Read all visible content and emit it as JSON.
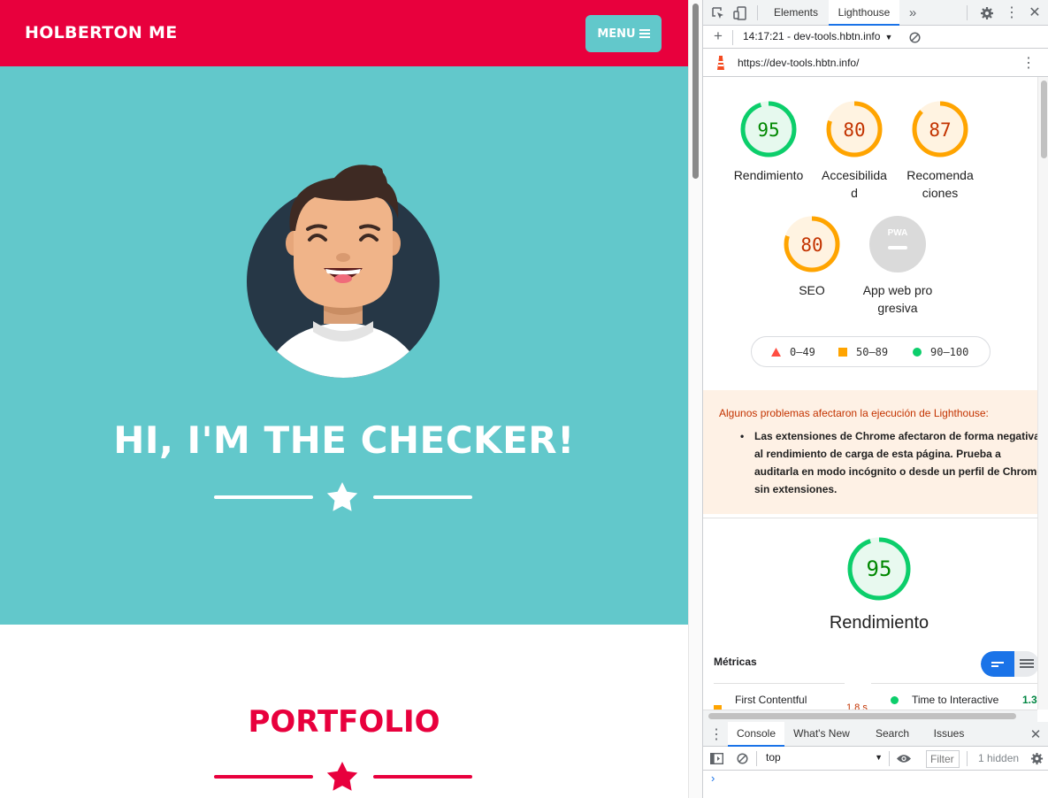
{
  "site": {
    "brand": "HOLBERTON ME",
    "menu_label": "MENU",
    "hero_title": "HI, I'M THE CHECKER!",
    "portfolio_title": "PORTFOLIO",
    "colors": {
      "nav": "#e8003d",
      "hero": "#62c8cb",
      "accent": "#e8003d"
    }
  },
  "devtools": {
    "tabs": [
      "Elements",
      "Lighthouse"
    ],
    "active_tab": "Lighthouse",
    "session": "14:17:21 - dev-tools.hbtn.info",
    "url": "https://dev-tools.hbtn.info/",
    "gauges": [
      {
        "score": "95",
        "label": "Rendimiento",
        "status": "pass"
      },
      {
        "score": "80",
        "label": "Accesibilidad",
        "status": "average"
      },
      {
        "score": "87",
        "label": "Recomendaciones",
        "status": "average"
      },
      {
        "score": "80",
        "label": "SEO",
        "status": "average"
      },
      {
        "score": "",
        "label": "App web progresiva",
        "status": "pwa"
      }
    ],
    "pwa_badge": "PWA",
    "legend": [
      {
        "range": "0–49",
        "shape": "triangle",
        "color": "#ff4e42"
      },
      {
        "range": "50–89",
        "shape": "square",
        "color": "#ffa400"
      },
      {
        "range": "90–100",
        "shape": "circle",
        "color": "#0cce6b"
      }
    ],
    "warning": {
      "title": "Algunos problemas afectaron la ejecución de Lighthouse:",
      "item": "Las extensiones de Chrome afectaron de forma negativa al rendimiento de carga de esta página. Prueba a auditarla en modo incógnito o desde un perfil de Chrome sin extensiones."
    },
    "performance": {
      "score": "95",
      "title": "Rendimiento"
    },
    "metrics_label": "Métricas",
    "metrics": [
      {
        "name": "First Contentful",
        "value": "1.8 s",
        "status": "average"
      },
      {
        "name": "Time to Interactive",
        "value": "1.3",
        "status": "pass"
      }
    ],
    "drawer_tabs": [
      "Console",
      "What's New",
      "Search",
      "Issues"
    ],
    "active_drawer_tab": "Console",
    "context": "top",
    "filter_placeholder": "Filter",
    "hidden_count": "1 hidden",
    "prompt": "›"
  }
}
